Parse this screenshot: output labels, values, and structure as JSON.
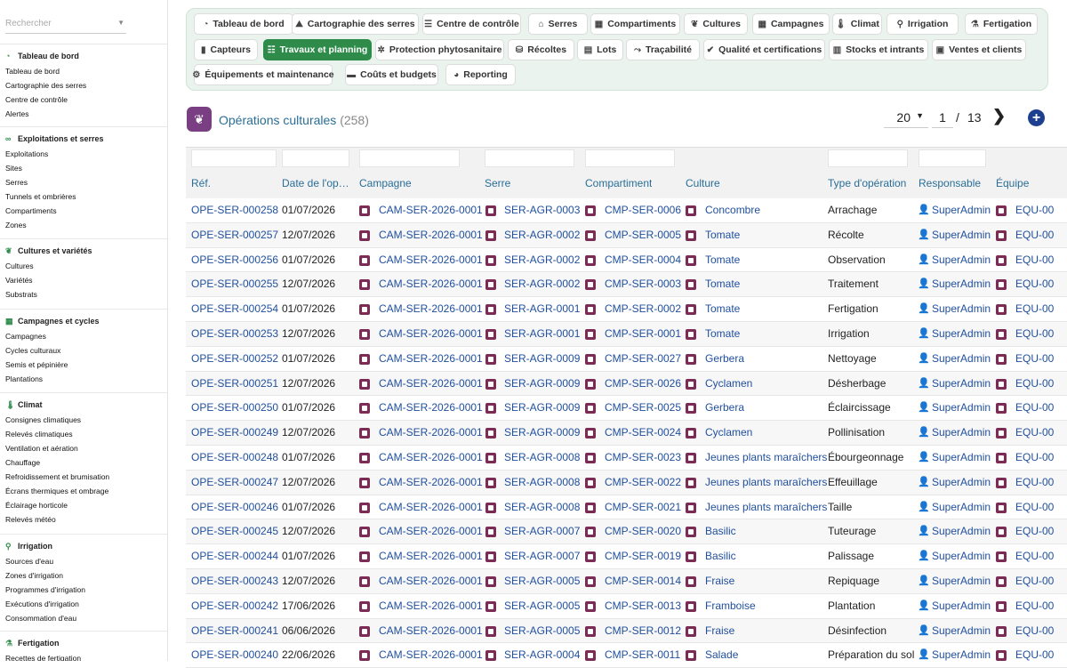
{
  "sidebar": {
    "search_placeholder": "Rechercher",
    "sections": [
      {
        "title": "Tableau de bord",
        "icon": "dashboard-icon",
        "items": [
          "Tableau de bord",
          "Cartographie des serres",
          "Centre de contrôle",
          "Alertes"
        ]
      },
      {
        "title": "Exploitations et serres",
        "icon": "binoculars-icon",
        "items": [
          "Exploitations",
          "Sites",
          "Serres",
          "Tunnels et ombrières",
          "Compartiments",
          "Zones"
        ]
      },
      {
        "title": "Cultures et variétés",
        "icon": "seedling-icon",
        "items": [
          "Cultures",
          "Variétés",
          "Substrats"
        ]
      },
      {
        "title": "Campagnes et cycles",
        "icon": "calendar-icon",
        "items": [
          "Campagnes",
          "Cycles culturaux",
          "Semis et pépinière",
          "Plantations"
        ]
      },
      {
        "title": "Climat",
        "icon": "thermometer-icon",
        "items": [
          "Consignes climatiques",
          "Relevés climatiques",
          "Ventilation et aération",
          "Chauffage",
          "Refroidissement et brumisation",
          "Écrans thermiques et ombrage",
          "Éclairage horticole",
          "Relevés météo"
        ]
      },
      {
        "title": "Irrigation",
        "icon": "faucet-icon",
        "items": [
          "Sources d'eau",
          "Zones d'irrigation",
          "Programmes d'irrigation",
          "Exécutions d'irrigation",
          "Consommation d'eau"
        ]
      },
      {
        "title": "Fertigation",
        "icon": "flask-icon",
        "items": [
          "Recettes de fertigation"
        ]
      }
    ]
  },
  "nav": {
    "buttons": [
      {
        "label": "Tableau de bord",
        "icon": "dashboard-icon"
      },
      {
        "label": "Cartographie des serres",
        "icon": "map-icon"
      },
      {
        "label": "Centre de contrôle",
        "icon": "sliders-icon"
      },
      {
        "label": "Serres",
        "icon": "greenhouse-icon"
      },
      {
        "label": "Compartiments",
        "icon": "grid-icon"
      },
      {
        "label": "Cultures",
        "icon": "seedling-icon"
      },
      {
        "label": "Campagnes",
        "icon": "calendar-icon"
      },
      {
        "label": "Climat",
        "icon": "thermometer-icon"
      },
      {
        "label": "Irrigation",
        "icon": "faucet-icon"
      },
      {
        "label": "Fertigation",
        "icon": "flask-icon"
      },
      {
        "label": "Capteurs",
        "icon": "sensor-icon"
      },
      {
        "label": "Travaux et planning",
        "icon": "list-icon",
        "active": true
      },
      {
        "label": "Protection phytosanitaire",
        "icon": "spray-icon"
      },
      {
        "label": "Récoltes",
        "icon": "basket-icon"
      },
      {
        "label": "Lots",
        "icon": "boxes-icon"
      },
      {
        "label": "Traçabilité",
        "icon": "route-icon"
      },
      {
        "label": "Qualité et certifications",
        "icon": "check-icon"
      },
      {
        "label": "Stocks et intrants",
        "icon": "warehouse-icon"
      },
      {
        "label": "Ventes et clients",
        "icon": "invoice-icon"
      },
      {
        "label": "Équipements et maintenance",
        "icon": "gears-icon"
      },
      {
        "label": "Coûts et budgets",
        "icon": "money-icon"
      },
      {
        "label": "Reporting",
        "icon": "chart-pie-icon"
      }
    ]
  },
  "page": {
    "title": "Opérations culturales",
    "count": "(258)",
    "page_size": "20",
    "current_page": "1",
    "page_separator": "/",
    "total_pages": "13"
  },
  "table": {
    "columns": [
      "Réf.",
      "Date de l'op…",
      "Campagne",
      "Serre",
      "Compartiment",
      "Culture",
      "Type d'opération",
      "Responsable",
      "Équipe"
    ],
    "rows": [
      {
        "ref": "OPE-SER-000258",
        "date": "01/07/2026",
        "campagne": "CAM-SER-2026-0001",
        "serre": "SER-AGR-0003",
        "comp": "CMP-SER-0006",
        "culture": "Concombre",
        "type": "Arrachage",
        "resp": "SuperAdmin",
        "equipe": "EQU-00"
      },
      {
        "ref": "OPE-SER-000257",
        "date": "12/07/2026",
        "campagne": "CAM-SER-2026-0001",
        "serre": "SER-AGR-0002",
        "comp": "CMP-SER-0005",
        "culture": "Tomate",
        "type": "Récolte",
        "resp": "SuperAdmin",
        "equipe": "EQU-00"
      },
      {
        "ref": "OPE-SER-000256",
        "date": "01/07/2026",
        "campagne": "CAM-SER-2026-0001",
        "serre": "SER-AGR-0002",
        "comp": "CMP-SER-0004",
        "culture": "Tomate",
        "type": "Observation",
        "resp": "SuperAdmin",
        "equipe": "EQU-00"
      },
      {
        "ref": "OPE-SER-000255",
        "date": "12/07/2026",
        "campagne": "CAM-SER-2026-0001",
        "serre": "SER-AGR-0002",
        "comp": "CMP-SER-0003",
        "culture": "Tomate",
        "type": "Traitement",
        "resp": "SuperAdmin",
        "equipe": "EQU-00"
      },
      {
        "ref": "OPE-SER-000254",
        "date": "01/07/2026",
        "campagne": "CAM-SER-2026-0001",
        "serre": "SER-AGR-0001",
        "comp": "CMP-SER-0002",
        "culture": "Tomate",
        "type": "Fertigation",
        "resp": "SuperAdmin",
        "equipe": "EQU-00"
      },
      {
        "ref": "OPE-SER-000253",
        "date": "12/07/2026",
        "campagne": "CAM-SER-2026-0001",
        "serre": "SER-AGR-0001",
        "comp": "CMP-SER-0001",
        "culture": "Tomate",
        "type": "Irrigation",
        "resp": "SuperAdmin",
        "equipe": "EQU-00"
      },
      {
        "ref": "OPE-SER-000252",
        "date": "01/07/2026",
        "campagne": "CAM-SER-2026-0001",
        "serre": "SER-AGR-0009",
        "comp": "CMP-SER-0027",
        "culture": "Gerbera",
        "type": "Nettoyage",
        "resp": "SuperAdmin",
        "equipe": "EQU-00"
      },
      {
        "ref": "OPE-SER-000251",
        "date": "12/07/2026",
        "campagne": "CAM-SER-2026-0001",
        "serre": "SER-AGR-0009",
        "comp": "CMP-SER-0026",
        "culture": "Cyclamen",
        "type": "Désherbage",
        "resp": "SuperAdmin",
        "equipe": "EQU-00"
      },
      {
        "ref": "OPE-SER-000250",
        "date": "01/07/2026",
        "campagne": "CAM-SER-2026-0001",
        "serre": "SER-AGR-0009",
        "comp": "CMP-SER-0025",
        "culture": "Gerbera",
        "type": "Éclaircissage",
        "resp": "SuperAdmin",
        "equipe": "EQU-00"
      },
      {
        "ref": "OPE-SER-000249",
        "date": "12/07/2026",
        "campagne": "CAM-SER-2026-0001",
        "serre": "SER-AGR-0009",
        "comp": "CMP-SER-0024",
        "culture": "Cyclamen",
        "type": "Pollinisation",
        "resp": "SuperAdmin",
        "equipe": "EQU-00"
      },
      {
        "ref": "OPE-SER-000248",
        "date": "01/07/2026",
        "campagne": "CAM-SER-2026-0001",
        "serre": "SER-AGR-0008",
        "comp": "CMP-SER-0023",
        "culture": "Jeunes plants maraîchers",
        "type": "Ébourgeonnage",
        "resp": "SuperAdmin",
        "equipe": "EQU-00"
      },
      {
        "ref": "OPE-SER-000247",
        "date": "12/07/2026",
        "campagne": "CAM-SER-2026-0001",
        "serre": "SER-AGR-0008",
        "comp": "CMP-SER-0022",
        "culture": "Jeunes plants maraîchers",
        "type": "Effeuillage",
        "resp": "SuperAdmin",
        "equipe": "EQU-00"
      },
      {
        "ref": "OPE-SER-000246",
        "date": "01/07/2026",
        "campagne": "CAM-SER-2026-0001",
        "serre": "SER-AGR-0008",
        "comp": "CMP-SER-0021",
        "culture": "Jeunes plants maraîchers",
        "type": "Taille",
        "resp": "SuperAdmin",
        "equipe": "EQU-00"
      },
      {
        "ref": "OPE-SER-000245",
        "date": "12/07/2026",
        "campagne": "CAM-SER-2026-0001",
        "serre": "SER-AGR-0007",
        "comp": "CMP-SER-0020",
        "culture": "Basilic",
        "type": "Tuteurage",
        "resp": "SuperAdmin",
        "equipe": "EQU-00"
      },
      {
        "ref": "OPE-SER-000244",
        "date": "01/07/2026",
        "campagne": "CAM-SER-2026-0001",
        "serre": "SER-AGR-0007",
        "comp": "CMP-SER-0019",
        "culture": "Basilic",
        "type": "Palissage",
        "resp": "SuperAdmin",
        "equipe": "EQU-00"
      },
      {
        "ref": "OPE-SER-000243",
        "date": "12/07/2026",
        "campagne": "CAM-SER-2026-0001",
        "serre": "SER-AGR-0005",
        "comp": "CMP-SER-0014",
        "culture": "Fraise",
        "type": "Repiquage",
        "resp": "SuperAdmin",
        "equipe": "EQU-00"
      },
      {
        "ref": "OPE-SER-000242",
        "date": "17/06/2026",
        "campagne": "CAM-SER-2026-0001",
        "serre": "SER-AGR-0005",
        "comp": "CMP-SER-0013",
        "culture": "Framboise",
        "type": "Plantation",
        "resp": "SuperAdmin",
        "equipe": "EQU-00"
      },
      {
        "ref": "OPE-SER-000241",
        "date": "06/06/2026",
        "campagne": "CAM-SER-2026-0001",
        "serre": "SER-AGR-0005",
        "comp": "CMP-SER-0012",
        "culture": "Fraise",
        "type": "Désinfection",
        "resp": "SuperAdmin",
        "equipe": "EQU-00"
      },
      {
        "ref": "OPE-SER-000240",
        "date": "22/06/2026",
        "campagne": "CAM-SER-2026-0001",
        "serre": "SER-AGR-0004",
        "comp": "CMP-SER-0011",
        "culture": "Salade",
        "type": "Préparation du sol",
        "resp": "SuperAdmin",
        "equipe": "EQU-00"
      }
    ]
  },
  "colors": {
    "accent": "#2e8b4a",
    "link": "#1f4f9e",
    "header_text": "#2a6e97",
    "relation_icon": "#7b2c55",
    "add_button": "#1e3f8f"
  }
}
